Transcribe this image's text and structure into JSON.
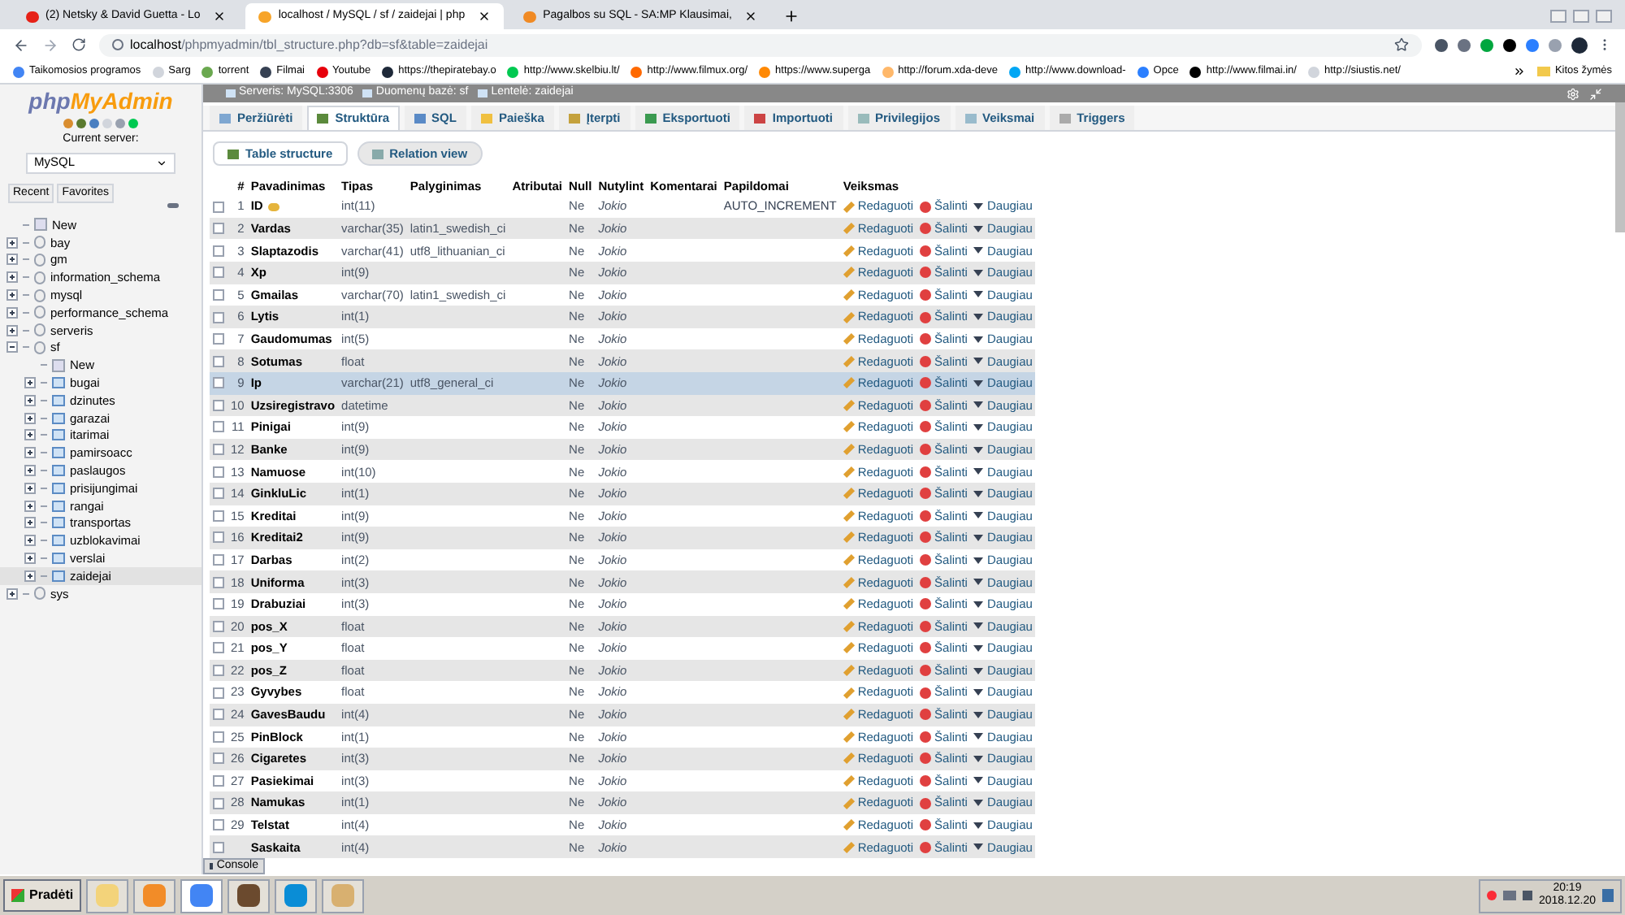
{
  "browser": {
    "tabs": [
      {
        "title": "(2) Netsky & David Guetta - Lo",
        "selected": false,
        "kind": "video"
      },
      {
        "title": "localhost / MySQL / sf / zaidejai | php",
        "selected": true,
        "kind": "pma"
      },
      {
        "title": "Pagalbos su SQL - SA:MP Klausimai,",
        "selected": false,
        "kind": "forum"
      }
    ],
    "url_host": "localhost",
    "url_path": "/phpmyadmin/tbl_structure.php?db=sf&table=zaidejai",
    "bookmarks": [
      "Taikomosios programos",
      "Sarg",
      "torrent",
      "Filmai",
      "Youtube",
      "https://thepiratebay.o",
      "http://www.skelbiu.lt/",
      "http://www.filmux.org/",
      "https://www.superga",
      "http://forum.xda-deve",
      "http://www.download-",
      "Opce",
      "http://www.filmai.in/",
      "http://siustis.net/"
    ],
    "other_bookmarks": "Kitos žymės"
  },
  "sidebar": {
    "logo_a": "php",
    "logo_b": "MyAdmin",
    "server_label": "Current server:",
    "server": "MySQL",
    "tabs": [
      "Recent",
      "Favorites"
    ],
    "tree": [
      {
        "name": "New",
        "kind": "new",
        "selected": false
      },
      {
        "name": "bay",
        "kind": "db",
        "expanded": false,
        "selected": false
      },
      {
        "name": "gm",
        "kind": "db",
        "expanded": false,
        "selected": false
      },
      {
        "name": "information_schema",
        "kind": "db",
        "expanded": false,
        "selected": false
      },
      {
        "name": "mysql",
        "kind": "db",
        "expanded": false,
        "selected": false
      },
      {
        "name": "performance_schema",
        "kind": "db",
        "expanded": false,
        "selected": false
      },
      {
        "name": "serveris",
        "kind": "db",
        "expanded": false,
        "selected": false
      },
      {
        "name": "sf",
        "kind": "db",
        "expanded": true,
        "selected": false,
        "children": [
          {
            "name": "New",
            "kind": "new",
            "selected": false
          },
          {
            "name": "bugai",
            "kind": "table",
            "expanded": false,
            "selected": false
          },
          {
            "name": "dzinutes",
            "kind": "table",
            "expanded": false,
            "selected": false
          },
          {
            "name": "garazai",
            "kind": "table",
            "expanded": false,
            "selected": false
          },
          {
            "name": "itarimai",
            "kind": "table",
            "expanded": false,
            "selected": false
          },
          {
            "name": "pamirsoacc",
            "kind": "table",
            "expanded": false,
            "selected": false
          },
          {
            "name": "paslaugos",
            "kind": "table",
            "expanded": false,
            "selected": false
          },
          {
            "name": "prisijungimai",
            "kind": "table",
            "expanded": false,
            "selected": false
          },
          {
            "name": "rangai",
            "kind": "table",
            "expanded": false,
            "selected": false
          },
          {
            "name": "transportas",
            "kind": "table",
            "expanded": false,
            "selected": false
          },
          {
            "name": "uzblokavimai",
            "kind": "table",
            "expanded": false,
            "selected": false
          },
          {
            "name": "verslai",
            "kind": "table",
            "expanded": false,
            "selected": false
          },
          {
            "name": "zaidejai",
            "kind": "table",
            "expanded": false,
            "selected": true
          }
        ]
      },
      {
        "name": "sys",
        "kind": "db",
        "expanded": false,
        "selected": false
      }
    ]
  },
  "breadcrumb": [
    "Serveris: MySQL:3306",
    "Duomenų bazė: sf",
    "Lentelė: zaidejai"
  ],
  "tabs": [
    {
      "label": "Peržiūrėti",
      "selected": false
    },
    {
      "label": "Struktūra",
      "selected": true
    },
    {
      "label": "SQL",
      "selected": false
    },
    {
      "label": "Paieška",
      "selected": false
    },
    {
      "label": "Įterpti",
      "selected": false
    },
    {
      "label": "Eksportuoti",
      "selected": false
    },
    {
      "label": "Importuoti",
      "selected": false
    },
    {
      "label": "Privilegijos",
      "selected": false
    },
    {
      "label": "Veiksmai",
      "selected": false
    },
    {
      "label": "Triggers",
      "selected": false
    }
  ],
  "subtabs": [
    {
      "label": "Table structure",
      "selected": true
    },
    {
      "label": "Relation view",
      "selected": false
    }
  ],
  "table": {
    "columns": [
      "#",
      "Pavadinimas",
      "Tipas",
      "Palyginimas",
      "Atributai",
      "Null",
      "Nutylint",
      "Komentarai",
      "Papildomai",
      "Veiksmas"
    ],
    "rows": [
      {
        "n": "1",
        "name": "ID",
        "primary": true,
        "type": "int(11)",
        "null": "Ne",
        "default": "Jokio",
        "extra": "AUTO_INCREMENT",
        "selected": false,
        "actions": [
          "Redaguoti",
          "Šalinti",
          "Daugiau"
        ]
      },
      {
        "n": "2",
        "name": "Vardas",
        "type": "varchar(35)",
        "collation": "latin1_swedish_ci",
        "null": "Ne",
        "default": "Jokio",
        "selected": false,
        "actions": [
          "Redaguoti",
          "Šalinti",
          "Daugiau"
        ]
      },
      {
        "n": "3",
        "name": "Slaptazodis",
        "type": "varchar(41)",
        "collation": "utf8_lithuanian_ci",
        "null": "Ne",
        "default": "Jokio",
        "selected": false,
        "actions": [
          "Redaguoti",
          "Šalinti",
          "Daugiau"
        ]
      },
      {
        "n": "4",
        "name": "Xp",
        "type": "int(9)",
        "null": "Ne",
        "default": "Jokio",
        "selected": false,
        "actions": [
          "Redaguoti",
          "Šalinti",
          "Daugiau"
        ]
      },
      {
        "n": "5",
        "name": "Gmailas",
        "type": "varchar(70)",
        "collation": "latin1_swedish_ci",
        "null": "Ne",
        "default": "Jokio",
        "selected": false,
        "actions": [
          "Redaguoti",
          "Šalinti",
          "Daugiau"
        ]
      },
      {
        "n": "6",
        "name": "Lytis",
        "type": "int(1)",
        "null": "Ne",
        "default": "Jokio",
        "selected": false,
        "actions": [
          "Redaguoti",
          "Šalinti",
          "Daugiau"
        ]
      },
      {
        "n": "7",
        "name": "Gaudomumas",
        "type": "int(5)",
        "null": "Ne",
        "default": "Jokio",
        "selected": false,
        "actions": [
          "Redaguoti",
          "Šalinti",
          "Daugiau"
        ]
      },
      {
        "n": "8",
        "name": "Sotumas",
        "type": "float",
        "null": "Ne",
        "default": "Jokio",
        "selected": false,
        "actions": [
          "Redaguoti",
          "Šalinti",
          "Daugiau"
        ]
      },
      {
        "n": "9",
        "name": "Ip",
        "type": "varchar(21)",
        "collation": "utf8_general_ci",
        "null": "Ne",
        "default": "Jokio",
        "selected": true,
        "actions": [
          "Redaguoti",
          "Šalinti",
          "Daugiau"
        ]
      },
      {
        "n": "10",
        "name": "Uzsiregistravo",
        "type": "datetime",
        "null": "Ne",
        "default": "Jokio",
        "selected": false,
        "actions": [
          "Redaguoti",
          "Šalinti",
          "Daugiau"
        ]
      },
      {
        "n": "11",
        "name": "Pinigai",
        "type": "int(9)",
        "null": "Ne",
        "default": "Jokio",
        "selected": false,
        "actions": [
          "Redaguoti",
          "Šalinti",
          "Daugiau"
        ]
      },
      {
        "n": "12",
        "name": "Banke",
        "type": "int(9)",
        "null": "Ne",
        "default": "Jokio",
        "selected": false,
        "actions": [
          "Redaguoti",
          "Šalinti",
          "Daugiau"
        ]
      },
      {
        "n": "13",
        "name": "Namuose",
        "type": "int(10)",
        "null": "Ne",
        "default": "Jokio",
        "selected": false,
        "actions": [
          "Redaguoti",
          "Šalinti",
          "Daugiau"
        ]
      },
      {
        "n": "14",
        "name": "GinkluLic",
        "type": "int(1)",
        "null": "Ne",
        "default": "Jokio",
        "selected": false,
        "actions": [
          "Redaguoti",
          "Šalinti",
          "Daugiau"
        ]
      },
      {
        "n": "15",
        "name": "Kreditai",
        "type": "int(9)",
        "null": "Ne",
        "default": "Jokio",
        "selected": false,
        "actions": [
          "Redaguoti",
          "Šalinti",
          "Daugiau"
        ]
      },
      {
        "n": "16",
        "name": "Kreditai2",
        "type": "int(9)",
        "null": "Ne",
        "default": "Jokio",
        "selected": false,
        "actions": [
          "Redaguoti",
          "Šalinti",
          "Daugiau"
        ]
      },
      {
        "n": "17",
        "name": "Darbas",
        "type": "int(2)",
        "null": "Ne",
        "default": "Jokio",
        "selected": false,
        "actions": [
          "Redaguoti",
          "Šalinti",
          "Daugiau"
        ]
      },
      {
        "n": "18",
        "name": "Uniforma",
        "type": "int(3)",
        "null": "Ne",
        "default": "Jokio",
        "selected": false,
        "actions": [
          "Redaguoti",
          "Šalinti",
          "Daugiau"
        ]
      },
      {
        "n": "19",
        "name": "Drabuziai",
        "type": "int(3)",
        "null": "Ne",
        "default": "Jokio",
        "selected": false,
        "actions": [
          "Redaguoti",
          "Šalinti",
          "Daugiau"
        ]
      },
      {
        "n": "20",
        "name": "pos_X",
        "type": "float",
        "null": "Ne",
        "default": "Jokio",
        "selected": false,
        "actions": [
          "Redaguoti",
          "Šalinti",
          "Daugiau"
        ]
      },
      {
        "n": "21",
        "name": "pos_Y",
        "type": "float",
        "null": "Ne",
        "default": "Jokio",
        "selected": false,
        "actions": [
          "Redaguoti",
          "Šalinti",
          "Daugiau"
        ]
      },
      {
        "n": "22",
        "name": "pos_Z",
        "type": "float",
        "null": "Ne",
        "default": "Jokio",
        "selected": false,
        "actions": [
          "Redaguoti",
          "Šalinti",
          "Daugiau"
        ]
      },
      {
        "n": "23",
        "name": "Gyvybes",
        "type": "float",
        "null": "Ne",
        "default": "Jokio",
        "selected": false,
        "actions": [
          "Redaguoti",
          "Šalinti",
          "Daugiau"
        ]
      },
      {
        "n": "24",
        "name": "GavesBaudu",
        "type": "int(4)",
        "null": "Ne",
        "default": "Jokio",
        "selected": false,
        "actions": [
          "Redaguoti",
          "Šalinti",
          "Daugiau"
        ]
      },
      {
        "n": "25",
        "name": "PinBlock",
        "type": "int(1)",
        "null": "Ne",
        "default": "Jokio",
        "selected": false,
        "actions": [
          "Redaguoti",
          "Šalinti",
          "Daugiau"
        ]
      },
      {
        "n": "26",
        "name": "Cigaretes",
        "type": "int(3)",
        "null": "Ne",
        "default": "Jokio",
        "selected": false,
        "actions": [
          "Redaguoti",
          "Šalinti",
          "Daugiau"
        ]
      },
      {
        "n": "27",
        "name": "Pasiekimai",
        "type": "int(3)",
        "null": "Ne",
        "default": "Jokio",
        "selected": false,
        "actions": [
          "Redaguoti",
          "Šalinti",
          "Daugiau"
        ]
      },
      {
        "n": "28",
        "name": "Namukas",
        "type": "int(1)",
        "null": "Ne",
        "default": "Jokio",
        "selected": false,
        "actions": [
          "Redaguoti",
          "Šalinti",
          "Daugiau"
        ]
      },
      {
        "n": "29",
        "name": "Telstat",
        "type": "int(4)",
        "null": "Ne",
        "default": "Jokio",
        "selected": false,
        "actions": [
          "Redaguoti",
          "Šalinti",
          "Daugiau"
        ]
      },
      {
        "name": "Saskaita",
        "type": "int(4)",
        "null": "Ne",
        "default": "Jokio",
        "selected": false,
        "actions": [
          "Redaguoti",
          "Šalinti",
          "Daugiau"
        ]
      }
    ]
  },
  "console": "Console",
  "taskbar": {
    "start": "Pradėti",
    "time": "20:19",
    "date": "2018.12.20"
  }
}
